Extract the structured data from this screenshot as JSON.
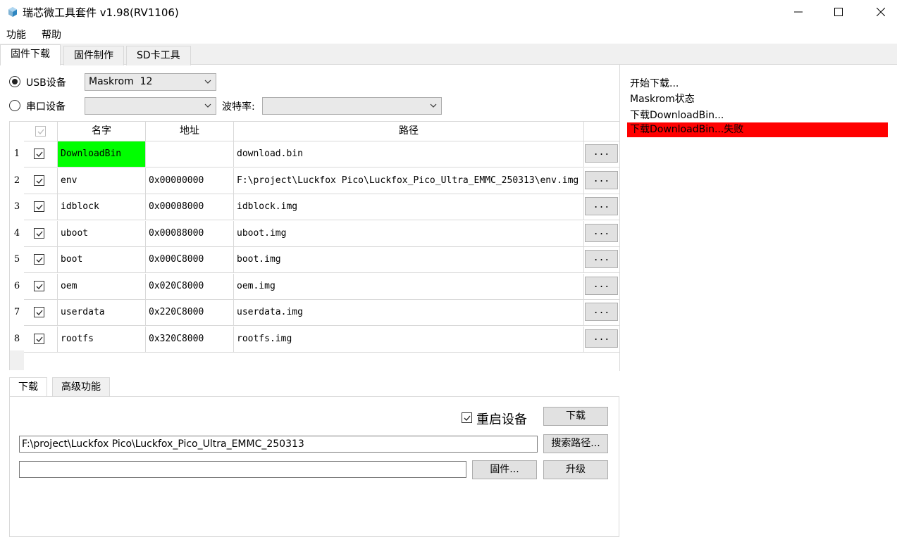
{
  "window": {
    "title": "瑞芯微工具套件 v1.98(RV1106)"
  },
  "menu": [
    "功能",
    "帮助"
  ],
  "tabs": [
    "固件下载",
    "固件制作",
    "SD卡工具"
  ],
  "device": {
    "usb_label": "USB设备",
    "usb_value": "Maskrom  12",
    "serial_label": "串口设备",
    "serial_value": "",
    "baud_label": "波特率:",
    "baud_value": ""
  },
  "table": {
    "headers": [
      "名字",
      "地址",
      "路径"
    ],
    "rows": [
      {
        "num": "1",
        "name": "DownloadBin",
        "addr": "",
        "path": "download.bin",
        "highlight": "#00ff00"
      },
      {
        "num": "2",
        "name": "env",
        "addr": "0x00000000",
        "path": "F:\\project\\Luckfox Pico\\Luckfox_Pico_Ultra_EMMC_250313\\env.img"
      },
      {
        "num": "3",
        "name": "idblock",
        "addr": "0x00008000",
        "path": "idblock.img"
      },
      {
        "num": "4",
        "name": "uboot",
        "addr": "0x00088000",
        "path": "uboot.img"
      },
      {
        "num": "5",
        "name": "boot",
        "addr": "0x000C8000",
        "path": "boot.img"
      },
      {
        "num": "6",
        "name": "oem",
        "addr": "0x020C8000",
        "path": "oem.img"
      },
      {
        "num": "7",
        "name": "userdata",
        "addr": "0x220C8000",
        "path": "userdata.img"
      },
      {
        "num": "8",
        "name": "rootfs",
        "addr": "0x320C8000",
        "path": "rootfs.img"
      }
    ],
    "browse_label": "..."
  },
  "log": {
    "lines": [
      "开始下载...",
      "Maskrom状态",
      "下载DownloadBin..."
    ],
    "error": "下载DownloadBin...失败",
    "error_color": "#ff0000"
  },
  "bottom": {
    "tabs": [
      "下载",
      "高级功能"
    ],
    "reboot_label": "重启设备",
    "download_button": "下载",
    "path_value": "F:\\project\\Luckfox Pico\\Luckfox_Pico_Ultra_EMMC_250313",
    "search_path_button": "搜索路径...",
    "firmware_value": "",
    "firmware_button": "固件...",
    "upgrade_button": "升级"
  }
}
